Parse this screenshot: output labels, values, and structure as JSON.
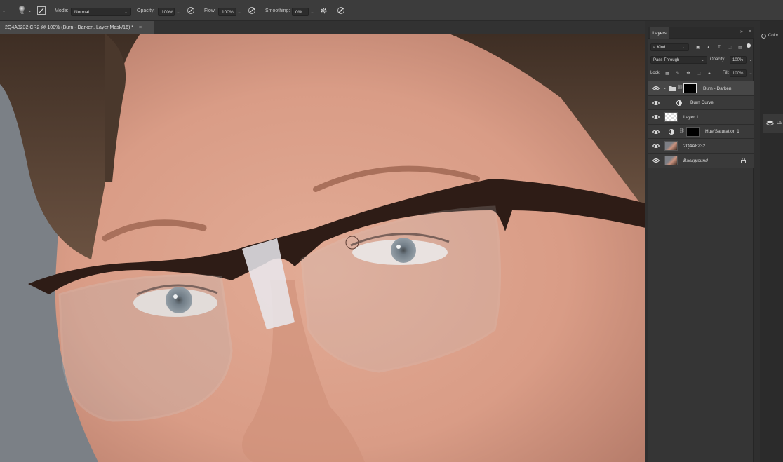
{
  "options_bar": {
    "brush_size": "45",
    "mode_label": "Mode:",
    "mode_value": "Normal",
    "opacity_label": "Opacity:",
    "opacity_value": "100%",
    "flow_label": "Flow:",
    "flow_value": "100%",
    "smoothing_label": "Smoothing:",
    "smoothing_value": "0%"
  },
  "document": {
    "tab_title": "2Q4A8232.CR2 @ 100% (Burn - Darken, Layer Mask/16) *",
    "close_glyph": "×"
  },
  "layers_panel": {
    "tab_label": "Layers",
    "filter_kind": "Kind",
    "blend_mode": "Pass Through",
    "opacity_label": "Opacity:",
    "opacity_value": "100%",
    "lock_label": "Lock:",
    "fill_label": "Fill:",
    "fill_value": "100%",
    "layers": [
      {
        "name": "Burn - Darken",
        "type": "group",
        "visible": true,
        "selected": true
      },
      {
        "name": "Burn Curve",
        "type": "adjustment-curves",
        "visible": true
      },
      {
        "name": "Layer 1",
        "type": "pixel-transparent",
        "visible": true
      },
      {
        "name": "Hue/Saturation 1",
        "type": "adjustment-hue-saturation",
        "visible": true
      },
      {
        "name": "2Q4A8232",
        "type": "smart-object",
        "visible": true
      },
      {
        "name": "Background",
        "type": "background",
        "visible": true,
        "locked": true
      }
    ]
  },
  "side_panel": {
    "color_tab_label": "Color",
    "layers_icon_label": "La"
  },
  "colors": {
    "app_bg": "#323232",
    "panel_bg": "#353535",
    "selected_layer": "#474747",
    "accent": "#e6e6e6"
  }
}
